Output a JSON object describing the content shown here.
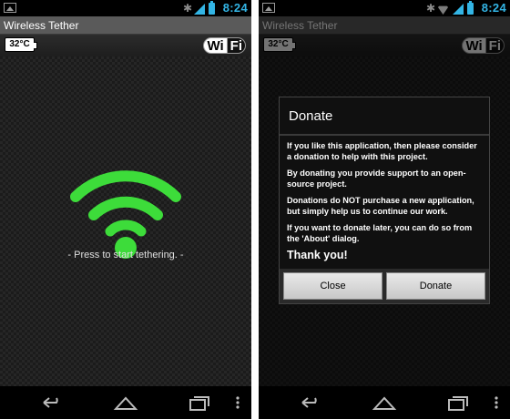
{
  "status_bar": {
    "time": "8:24"
  },
  "app": {
    "title": "Wireless Tether",
    "temperature": "32°C",
    "logo_left": "Wi",
    "logo_right": "Fi"
  },
  "main": {
    "hint": "- Press to start tethering. -"
  },
  "dialog": {
    "title": "Donate",
    "paragraphs": [
      "If you like this application, then please consider a donation to help with this project.",
      "By donating you provide support to an open-source project.",
      "Donations do NOT purchase a new application, but simply help us to continue our work.",
      "If you want to donate later, you can do so from the 'About' dialog."
    ],
    "closing": "Thank you!",
    "buttons": {
      "close": "Close",
      "donate": "Donate"
    }
  },
  "colors": {
    "accent_blue": "#33b5e5",
    "wifi_green": "#3ddc3a",
    "titlebar": "#5a5a5a"
  },
  "icons": [
    "notification-image-icon",
    "bluetooth-icon",
    "wifi-status-icon",
    "signal-icon",
    "battery-icon",
    "back-icon",
    "home-icon",
    "recent-apps-icon",
    "overflow-menu-icon"
  ]
}
